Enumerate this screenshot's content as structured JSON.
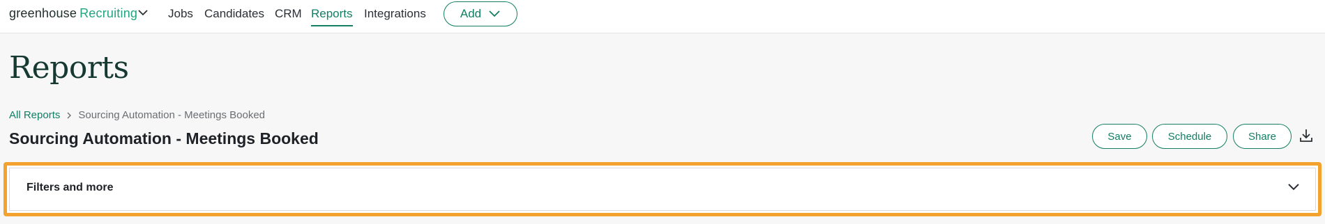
{
  "app": {
    "logo_main": "greenhouse",
    "logo_accent": "Recruiting"
  },
  "nav": {
    "items": [
      {
        "label": "Jobs"
      },
      {
        "label": "Candidates"
      },
      {
        "label": "CRM"
      },
      {
        "label": "Reports",
        "active": true
      },
      {
        "label": "Integrations"
      }
    ],
    "add_label": "Add"
  },
  "page": {
    "title": "Reports"
  },
  "breadcrumb": {
    "root": "All Reports",
    "current": "Sourcing Automation - Meetings Booked"
  },
  "report": {
    "title": "Sourcing Automation - Meetings Booked",
    "actions": {
      "save": "Save",
      "schedule": "Schedule",
      "share": "Share"
    }
  },
  "filters": {
    "label": "Filters and more"
  },
  "icons": {
    "logo_chevron": "chevron-down-icon",
    "add_chevron": "chevron-down-icon",
    "breadcrumb_separator": "chevron-right-icon",
    "download": "download-icon",
    "filters_chevron": "chevron-down-icon"
  },
  "colors": {
    "brand": "#137e62",
    "highlight": "#f4a22e",
    "title": "#163a32"
  }
}
